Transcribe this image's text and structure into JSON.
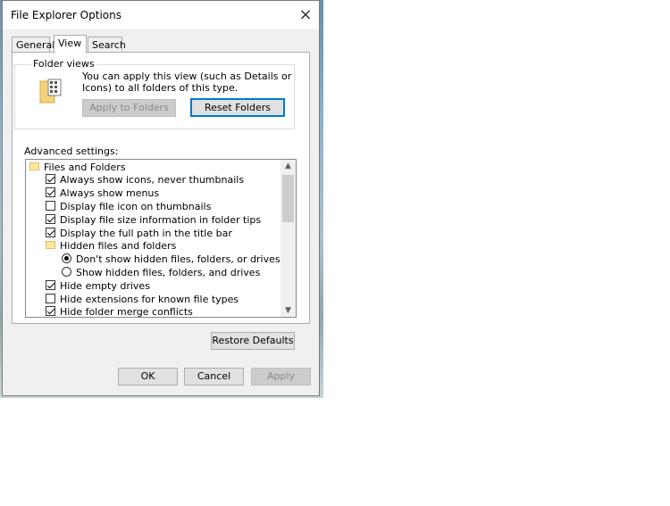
{
  "window": {
    "title": "File Explorer Options",
    "close_icon": "×"
  },
  "tabs": [
    {
      "label": "General"
    },
    {
      "label": "View"
    },
    {
      "label": "Search"
    }
  ],
  "folder_views": {
    "label": "Folder views",
    "description": "You can apply this view (such as Details or Icons) to all folders of this type.",
    "apply_label": "Apply to Folders",
    "reset_label": "Reset Folders"
  },
  "advanced": {
    "label": "Advanced settings:",
    "items": [
      {
        "kind": "folder",
        "label": "Files and Folders",
        "indent": 0
      },
      {
        "kind": "checkbox",
        "checked": true,
        "label": "Always show icons, never thumbnails",
        "indent": 1
      },
      {
        "kind": "checkbox",
        "checked": true,
        "label": "Always show menus",
        "indent": 1
      },
      {
        "kind": "checkbox",
        "checked": false,
        "label": "Display file icon on thumbnails",
        "indent": 1
      },
      {
        "kind": "checkbox",
        "checked": true,
        "label": "Display file size information in folder tips",
        "indent": 1
      },
      {
        "kind": "checkbox",
        "checked": true,
        "label": "Display the full path in the title bar",
        "indent": 1
      },
      {
        "kind": "folder",
        "label": "Hidden files and folders",
        "indent": 1
      },
      {
        "kind": "radio",
        "checked": true,
        "label": "Don't show hidden files, folders, or drives",
        "indent": 2
      },
      {
        "kind": "radio",
        "checked": false,
        "label": "Show hidden files, folders, and drives",
        "indent": 2
      },
      {
        "kind": "checkbox",
        "checked": true,
        "label": "Hide empty drives",
        "indent": 1
      },
      {
        "kind": "checkbox",
        "checked": false,
        "label": "Hide extensions for known file types",
        "indent": 1
      },
      {
        "kind": "checkbox",
        "checked": true,
        "label": "Hide folder merge conflicts",
        "indent": 1
      }
    ],
    "restore_label": "Restore Defaults"
  },
  "footer": {
    "ok_label": "OK",
    "cancel_label": "Cancel",
    "apply_label": "Apply"
  }
}
